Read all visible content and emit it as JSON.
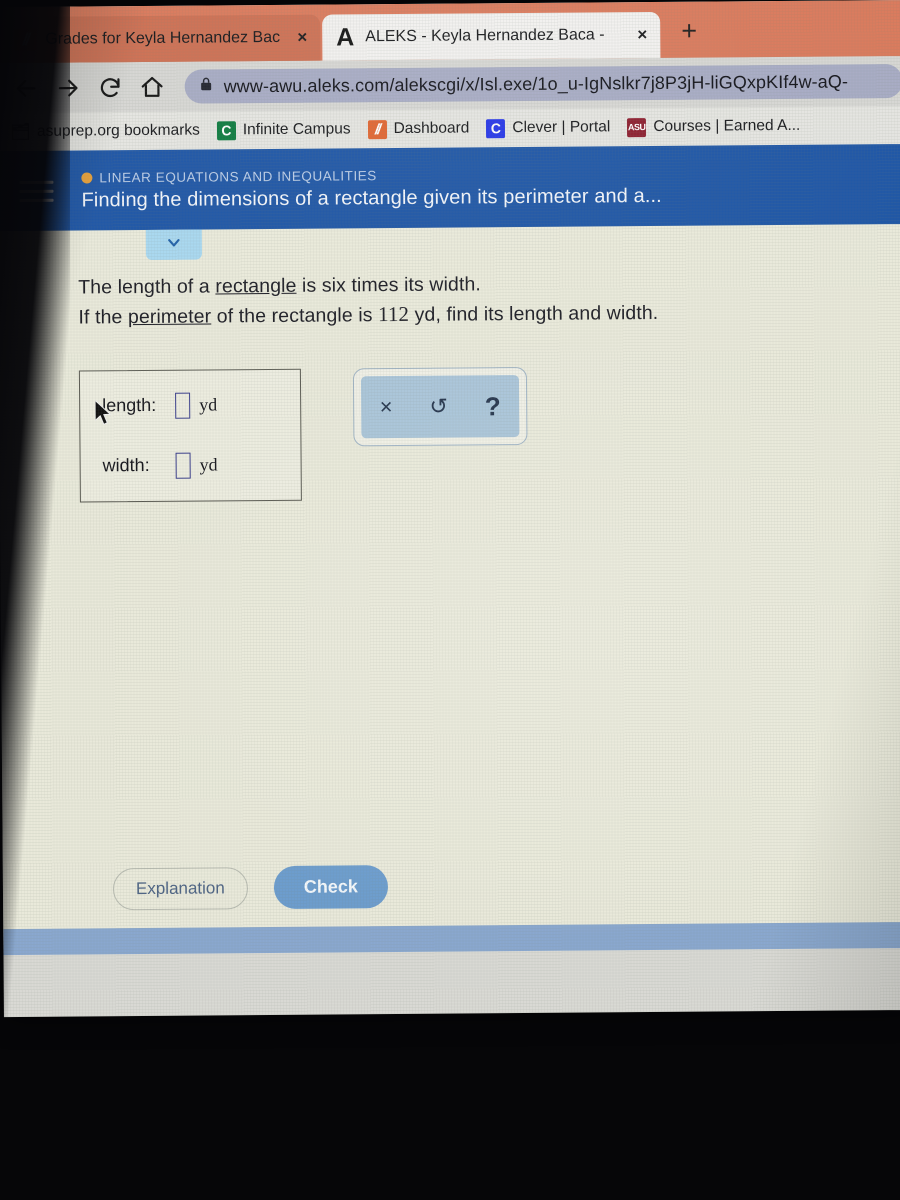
{
  "browser": {
    "tabs": [
      {
        "title": "Grades for Keyla Hernandez Bac",
        "close": "×",
        "favicon": "asu-icon",
        "active": false
      },
      {
        "title": "ALEKS - Keyla Hernandez Baca -",
        "close": "×",
        "favicon": "aleks-a-icon",
        "active": true
      }
    ],
    "new_tab_label": "+",
    "nav": {
      "back": "back-arrow-icon",
      "forward": "forward-arrow-icon",
      "reload": "reload-icon",
      "home": "home-icon"
    },
    "omnibox": {
      "lock": "lock-icon",
      "url": "www-awu.aleks.com/alekscgi/x/Isl.exe/1o_u-IgNslkr7j8P3jH-liGQxpKIf4w-aQ-"
    },
    "bookmarks": [
      {
        "label": "asuprep.org bookmarks",
        "icon": "folder-icon"
      },
      {
        "label": "Infinite Campus",
        "icon": "C",
        "color": "#0c7a3e"
      },
      {
        "label": "Dashboard",
        "icon": "asu-icon",
        "color": "#e0642f"
      },
      {
        "label": "Clever | Portal",
        "icon": "C",
        "color": "#2434e8"
      },
      {
        "label": "Courses | Earned A...",
        "icon": "ASU",
        "color": "#8c1d2e"
      }
    ]
  },
  "aleks": {
    "menu_icon": "hamburger-menu-icon",
    "category": "LINEAR EQUATIONS AND INEQUALITIES",
    "title": "Finding the dimensions of a rectangle given its perimeter and a...",
    "collapse_icon": "chevron-down-icon",
    "question": {
      "line1_pre": "The length of a ",
      "line1_link": "rectangle",
      "line1_post": " is six times its width.",
      "line2_pre": "If the ",
      "line2_link": "perimeter",
      "line2_mid": " of the rectangle is ",
      "line2_value": "112",
      "line2_post": " yd, find its length and width."
    },
    "answer": {
      "fields": [
        {
          "label": "length:",
          "value": "",
          "unit": "yd"
        },
        {
          "label": "width:",
          "value": "",
          "unit": "yd"
        }
      ]
    },
    "toolbar": {
      "clear": "×",
      "undo": "↺",
      "help": "?"
    },
    "buttons": {
      "explanation": "Explanation",
      "check": "Check"
    }
  },
  "colors": {
    "header_blue": "#1d55a5",
    "page_bg": "#e9e9da",
    "tabstrip": "#d9795b",
    "accent_orange": "#e8a13a",
    "check_blue": "#6d9dcd",
    "footer_blue": "#8aa8cf",
    "toolbar_blue": "#a9c4d8"
  }
}
